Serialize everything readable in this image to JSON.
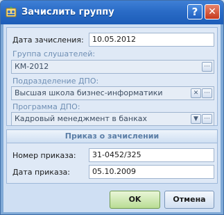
{
  "window": {
    "title": "Зачислить группу",
    "help_label": "?",
    "close_label": "✕"
  },
  "form": {
    "enrollment_date": {
      "label": "Дата зачисления:",
      "value": "10.05.2012"
    },
    "group": {
      "label": "Группа слушателей:",
      "value": "КМ-2012"
    },
    "division": {
      "label": "Подразделение ДПО:",
      "value": "Высшая школа бизнес-информатики"
    },
    "program": {
      "label": "Программа ДПО:",
      "value": "Кадровый менеджмент в банках"
    }
  },
  "order": {
    "header": "Приказ о зачислении",
    "number": {
      "label": "Номер приказа:",
      "value": "31-0452/325"
    },
    "date": {
      "label": "Дата приказа:",
      "value": "05.10.2009"
    }
  },
  "buttons": {
    "ok": "OK",
    "cancel": "Отмена"
  },
  "icons": {
    "ellipsis": "···",
    "clear": "✕",
    "dropdown": "▼"
  }
}
